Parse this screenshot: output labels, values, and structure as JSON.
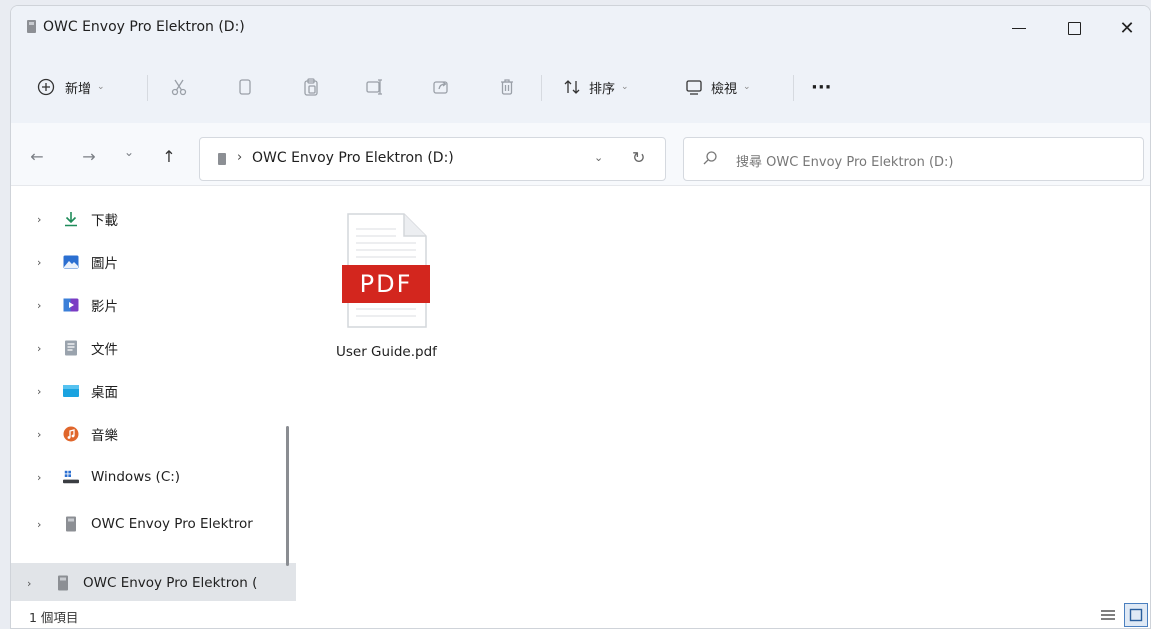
{
  "window": {
    "title": "OWC Envoy Pro Elektron (D:)",
    "minimize_label": "minimize",
    "maximize_label": "maximize",
    "close_glyph": "✕"
  },
  "toolbar": {
    "new_label": "新增",
    "sort_label": "排序",
    "view_label": "檢視",
    "more_label": "···",
    "icons": [
      "plus-circle-icon",
      "cut-icon",
      "copy-icon",
      "paste-icon",
      "rename-icon",
      "share-icon",
      "delete-icon",
      "sort-icon",
      "view-icon",
      "more-icon"
    ]
  },
  "address": {
    "back": "←",
    "forward": "→",
    "recent": "⌄",
    "up": "↑",
    "separator": "›",
    "path": "OWC Envoy Pro Elektron (D:)",
    "dropdown": "⌄",
    "refresh": "↻"
  },
  "search": {
    "placeholder": "搜尋 OWC Envoy Pro Elektron (D:)"
  },
  "sidebar": {
    "expand_glyph": "›",
    "items": [
      {
        "label": "下載",
        "icon": "download-icon"
      },
      {
        "label": "圖片",
        "icon": "pictures-icon"
      },
      {
        "label": "影片",
        "icon": "videos-icon"
      },
      {
        "label": "文件",
        "icon": "documents-icon"
      },
      {
        "label": "桌面",
        "icon": "desktop-icon"
      },
      {
        "label": "音樂",
        "icon": "music-icon"
      },
      {
        "label": "Windows (C:)",
        "icon": "windows-drive-icon"
      },
      {
        "label": "OWC Envoy Pro Elektror",
        "icon": "drive-icon"
      },
      {
        "label": "OWC Envoy Pro Elektron (",
        "icon": "drive-icon"
      }
    ]
  },
  "files": [
    {
      "name": "User Guide.pdf",
      "badge": "PDF",
      "icon": "pdf-file-icon"
    }
  ],
  "status": {
    "item_count": "1 個項目"
  },
  "colors": {
    "pdf_red": "#d3261e",
    "accent": "#4a7fbf",
    "chrome": "#eef2f8"
  }
}
